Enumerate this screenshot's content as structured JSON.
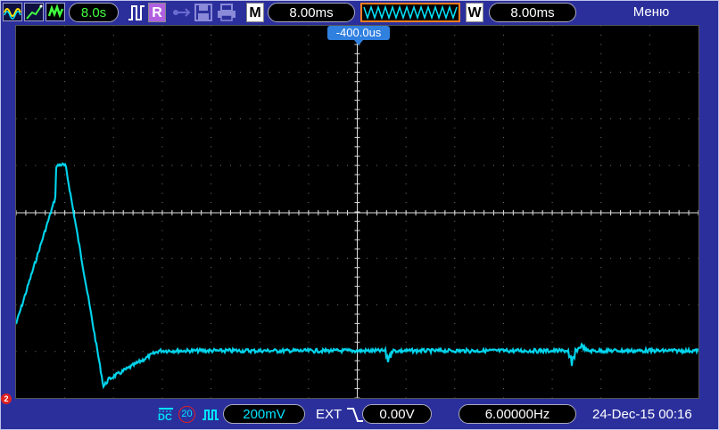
{
  "toolbar": {
    "run_time": "8.0s",
    "run_badge": "R",
    "m_label": "M",
    "timebase": "8.00ms",
    "w_label": "W",
    "window_timebase": "8.00ms",
    "menu_label": "Меню"
  },
  "screen": {
    "trigger_offset": "-400.0us",
    "channel_marker": "2"
  },
  "bottom": {
    "coupling": "DC",
    "channel_num": "20",
    "volts_div": "200mV",
    "trigger_source": "EXT",
    "trigger_level": "0.00V",
    "frequency": "6.00000Hz",
    "datetime": "24-Dec-15 00:16"
  },
  "colors": {
    "background": "#2b2f9c",
    "trace": "#00e5ff",
    "trigger_marker": "#3080e0"
  }
}
